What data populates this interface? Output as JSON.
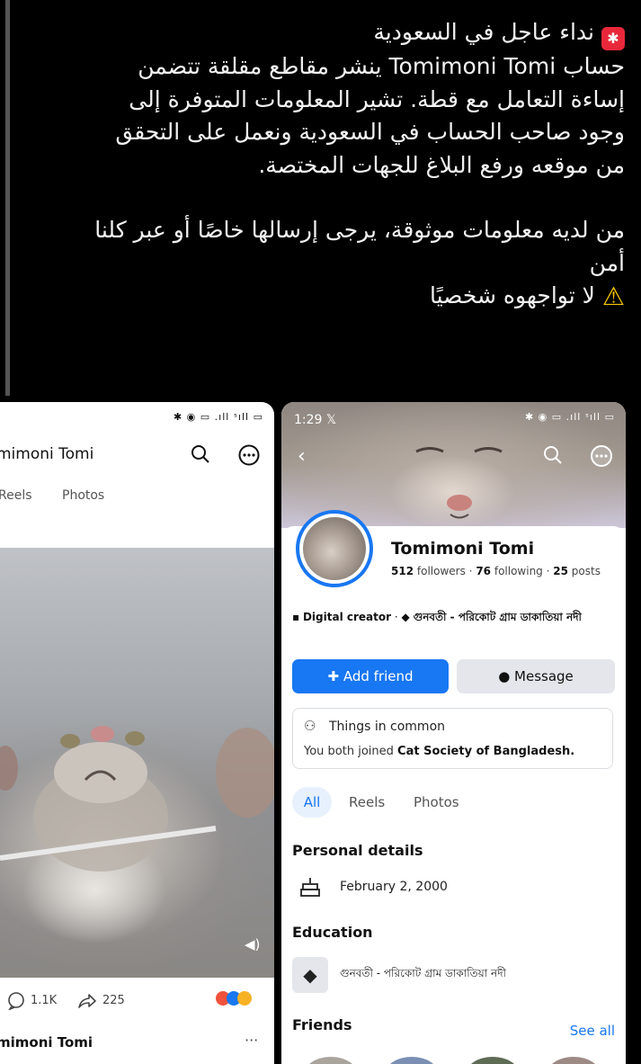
{
  "post": {
    "title": "نداء عاجل في السعودية",
    "line1": "حساب Tomimoni Tomi ينشر مقاطع مقلقة تتضمن",
    "line2": "إساءة التعامل مع قطة. تشير المعلومات المتوفرة إلى",
    "line3": "وجود صاحب الحساب في السعودية ونعمل على التحقق",
    "line4": "من موقعه ورفع البلاغ للجهات المختصة.",
    "line5": "من لديه معلومات موثوقة، يرجى إرسالها خاصًا أو عبر كلنا",
    "line6": "أمن",
    "line7": "لا تواجهوه شخصيًا",
    "siren_icon": "🚨",
    "warning_icon": "⚠️"
  },
  "left_phone": {
    "title": "mimoni Tomi",
    "tabs": [
      "Reels",
      "Photos"
    ],
    "comments": "1.1K",
    "shares": "225",
    "author": "mimoni Tomi",
    "more": "···"
  },
  "right_phone": {
    "time": "1:29",
    "name": "Tomimoni Tomi",
    "followers_count": "512",
    "followers_label": "followers",
    "following_count": "76",
    "following_label": "following",
    "posts_count": "25",
    "posts_label": "posts",
    "role": "Digital creator",
    "workplace": "গুনবতী - পরিকোট গ্রাম ডাকাতিয়া নদী",
    "add_friend": "Add friend",
    "message": "Message",
    "common_title": "Things in common",
    "common_prefix": "You both joined",
    "common_group": "Cat Society of Bangladesh.",
    "tabs": [
      "All",
      "Reels",
      "Photos"
    ],
    "personal_details": "Personal details",
    "birthday": "February 2, 2000",
    "education": "Education",
    "school": "গুনবতী - পরিকোট গ্রাম ডাকাতিয়া নদী",
    "friends": "Friends",
    "see_all": "See all"
  },
  "colors": {
    "accent": "#1877f2",
    "siren": "#e8283a",
    "warning": "#f5c400"
  }
}
